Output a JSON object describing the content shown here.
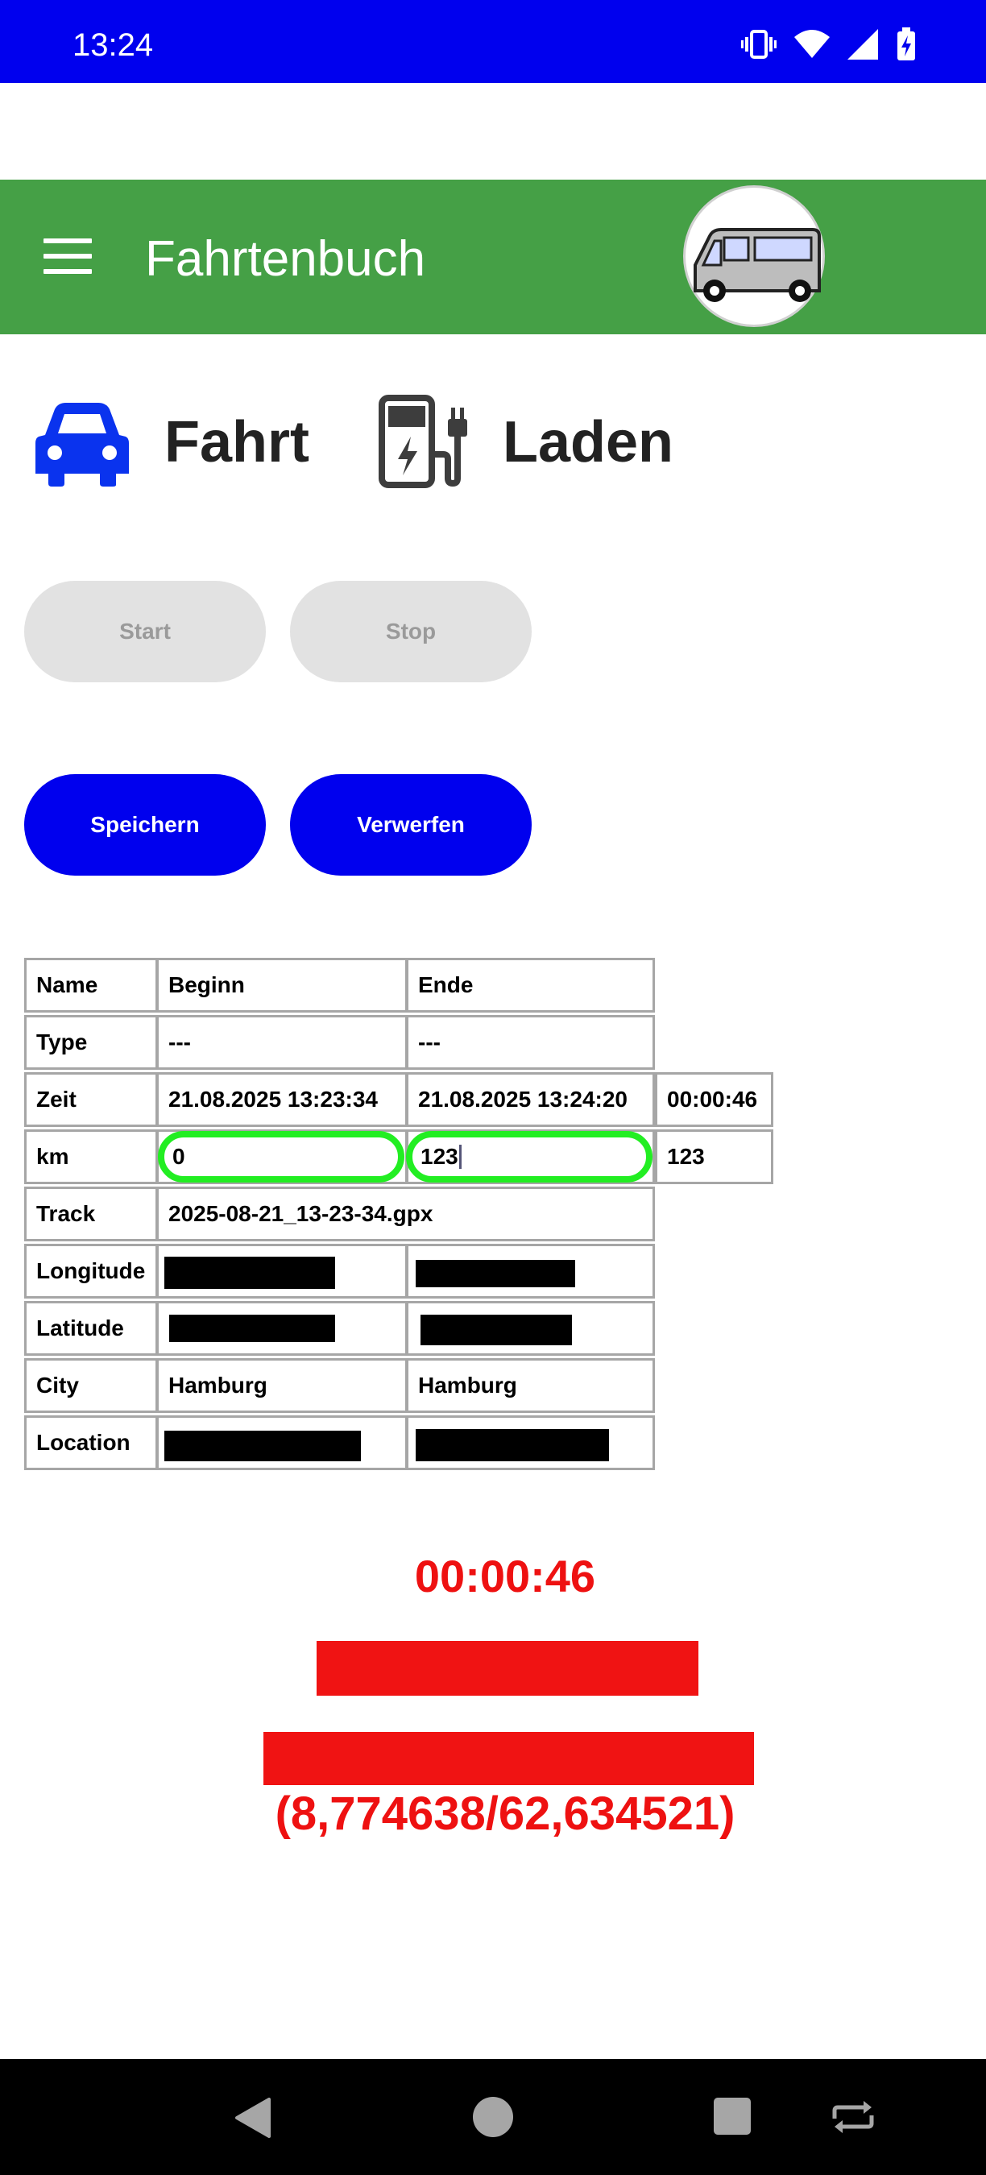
{
  "status_bar": {
    "time": "13:24"
  },
  "app_bar": {
    "title": "Fahrtenbuch"
  },
  "modes": {
    "drive_label": "Fahrt",
    "charge_label": "Laden"
  },
  "buttons": {
    "start": "Start",
    "stop": "Stop",
    "save": "Speichern",
    "discard": "Verwerfen"
  },
  "table": {
    "headers": {
      "name": "Name",
      "begin": "Beginn",
      "end": "Ende"
    },
    "type": {
      "label": "Type",
      "begin": "---",
      "end": "---"
    },
    "time": {
      "label": "Zeit",
      "begin": "21.08.2025 13:23:34",
      "end": "21.08.2025 13:24:20",
      "duration": "00:00:46"
    },
    "km": {
      "label": "km",
      "begin": "0",
      "end": "123",
      "distance": "123"
    },
    "track": {
      "label": "Track",
      "value": "2025-08-21_13-23-34.gpx"
    },
    "longitude": {
      "label": "Longitude"
    },
    "latitude": {
      "label": "Latitude"
    },
    "city": {
      "label": "City",
      "begin": "Hamburg",
      "end": "Hamburg"
    },
    "location": {
      "label": "Location"
    }
  },
  "live": {
    "timer": "00:00:46",
    "coords": "(8,774638/62,634521)"
  },
  "colors": {
    "status_bar": "#0000ee",
    "app_bar": "#45a046",
    "accent_blue": "#0000ee",
    "alert_red": "#ee1111",
    "input_border": "#22ee22"
  },
  "icons": [
    "vibrate-icon",
    "wifi-icon",
    "signal-icon",
    "battery-charging-icon",
    "menu-icon",
    "van-logo-icon",
    "car-icon",
    "ev-charger-icon",
    "back-icon",
    "home-icon",
    "recents-icon",
    "rotate-icon"
  ]
}
